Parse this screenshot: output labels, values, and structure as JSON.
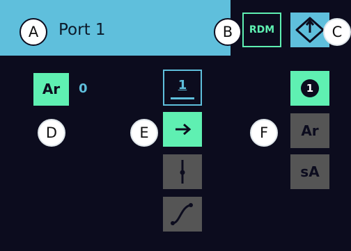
{
  "header": {
    "title": "Port 1",
    "rdm_label": "RDM",
    "callouts": {
      "a": "A",
      "b": "B",
      "c": "C"
    }
  },
  "left": {
    "ar_label": "Ar",
    "ar_value": "0",
    "callout": "D"
  },
  "middle": {
    "page_number": "1",
    "callout": "E"
  },
  "right": {
    "badge_number": "1",
    "ar_label": "Ar",
    "sa_label": "sA",
    "callout": "F"
  },
  "colors": {
    "background": "#0c0c1e",
    "header": "#5fbfdc",
    "accent_green": "#5ff0b2",
    "disabled_gray": "#555555"
  },
  "icons": [
    "rdm-button",
    "move-icon",
    "arrow-right-icon",
    "step-icon",
    "curve-icon",
    "badge-one-icon"
  ]
}
